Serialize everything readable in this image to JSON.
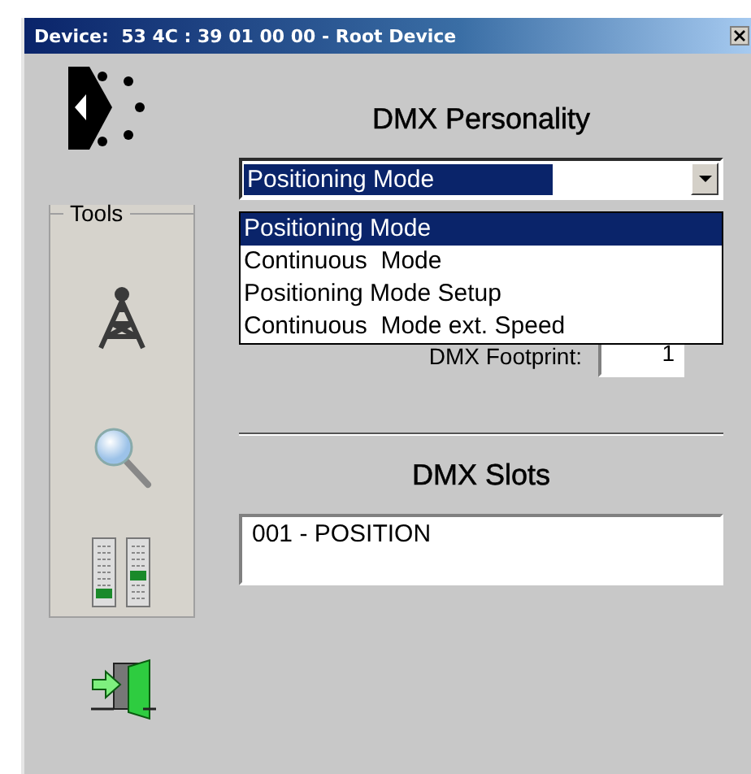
{
  "window": {
    "title": "Device:  53 4C : 39 01 00 00 - Root Device"
  },
  "tools": {
    "title": "Tools"
  },
  "personality": {
    "heading": "DMX Personality",
    "value": "Positioning Mode",
    "open": true,
    "options": [
      {
        "label": "Positioning Mode",
        "selected": true
      },
      {
        "label": "Continuous  Mode",
        "selected": false
      },
      {
        "label": "Positioning Mode Setup",
        "selected": false
      },
      {
        "label": "Continuous  Mode ext. Speed",
        "selected": false
      }
    ]
  },
  "footprint": {
    "label": "DMX Footprint:",
    "value": "1"
  },
  "slots": {
    "heading": "DMX Slots",
    "items": [
      {
        "label": "001 - POSITION"
      }
    ]
  }
}
